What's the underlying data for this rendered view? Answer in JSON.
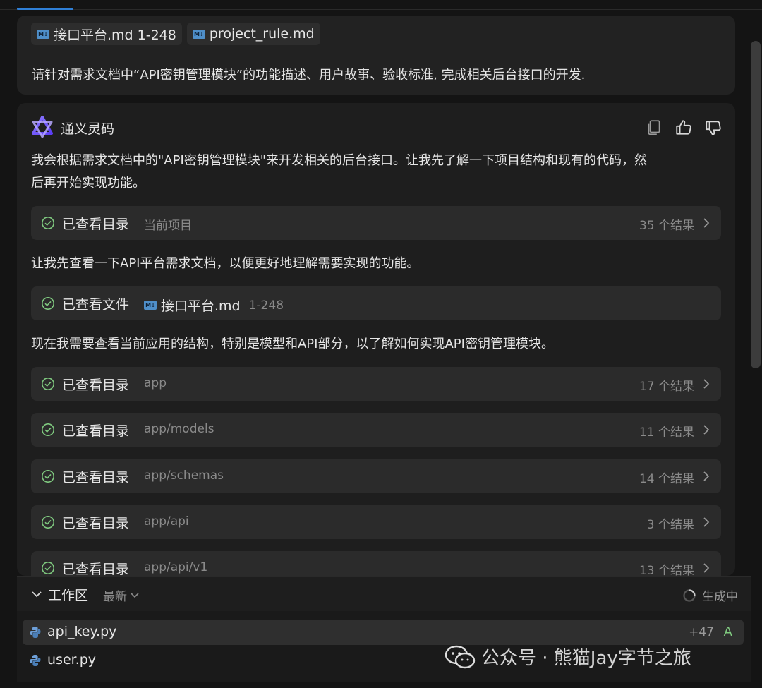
{
  "user_message": {
    "chips": [
      {
        "icon": "markdown-icon",
        "badge": "M↓",
        "label": "接口平台.md 1-248"
      },
      {
        "icon": "markdown-icon",
        "badge": "M↓",
        "label": "project_rule.md"
      }
    ],
    "text": "请针对需求文档中“API密钥管理模块”的功能描述、用户故事、验收标准, 完成相关后台接口的开发."
  },
  "assistant": {
    "name": "通义灵码",
    "intro_line1": "我会根据需求文档中的\"API密钥管理模块\"来开发相关的后台接口。让我先了解一下项目结构和现有的代码，然",
    "intro_line2": "后再开始实现功能。",
    "step1": {
      "label": "已查看目录",
      "target": "当前项目",
      "count": "35 个结果"
    },
    "para2": "让我先查看一下API平台需求文档，以便更好地理解需要实现的功能。",
    "step2": {
      "label": "已查看文件",
      "badge": "M↓",
      "file": "接口平台.md",
      "range": "1-248"
    },
    "para3": "现在我需要查看当前应用的结构，特别是模型和API部分，以了解如何实现API密钥管理模块。",
    "dir_steps": [
      {
        "label": "已查看目录",
        "target": "app",
        "count": "17 个结果"
      },
      {
        "label": "已查看目录",
        "target": "app/models",
        "count": "11 个结果"
      },
      {
        "label": "已查看目录",
        "target": "app/schemas",
        "count": "14 个结果"
      },
      {
        "label": "已查看目录",
        "target": "app/api",
        "count": "3 个结果"
      },
      {
        "label": "已查看目录",
        "target": "app/api/v1",
        "count": "13 个结果"
      }
    ]
  },
  "workspace": {
    "title": "工作区",
    "sort": "最新",
    "status": "生成中",
    "files": [
      {
        "name": "api_key.py",
        "diff": "+47",
        "status": "A"
      },
      {
        "name": "user.py",
        "diff": "",
        "status": ""
      }
    ]
  },
  "watermark": "公众号 · 熊猫Jay字节之旅",
  "colors": {
    "accent": "#2f7fd6",
    "success": "#7fc97f",
    "added": "#7fc97f"
  }
}
